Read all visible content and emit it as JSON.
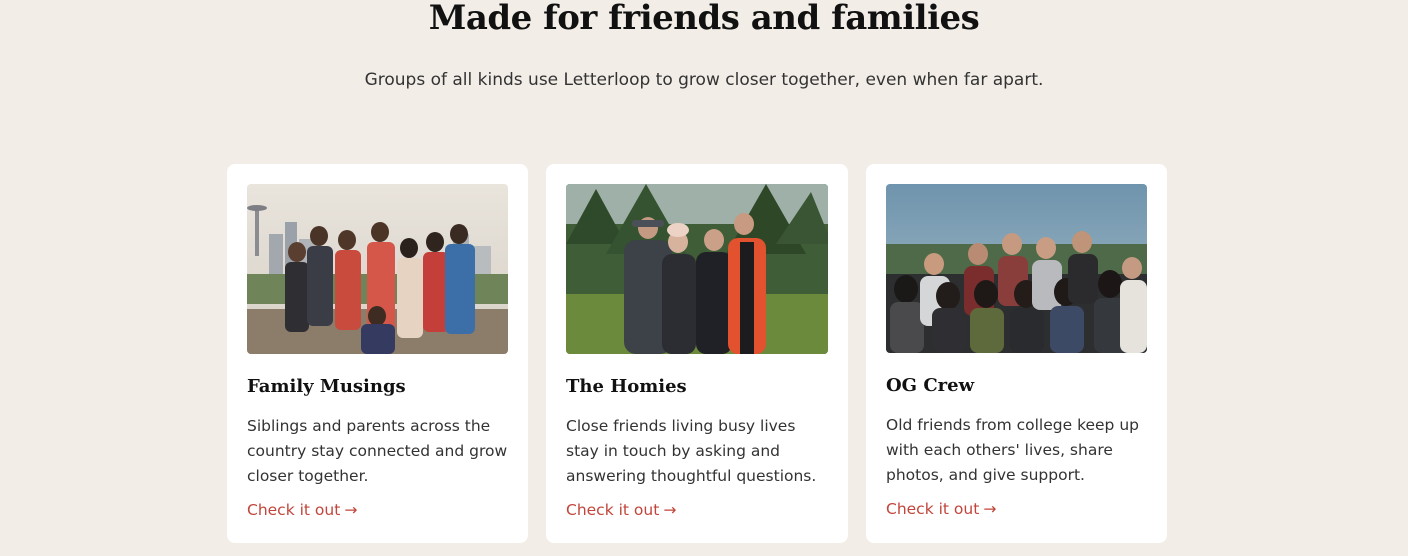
{
  "section": {
    "title": "Made for friends and families",
    "subtitle": "Groups of all kinds use Letterloop to grow closer together, even when far apart."
  },
  "cards": [
    {
      "title": "Family Musings",
      "description": "Siblings and parents across the country stay connected and grow closer together.",
      "link_label": "Check it out",
      "link_icon": "arrow-right-icon",
      "photo": "family-group-photo"
    },
    {
      "title": "The Homies",
      "description": "Close friends living busy lives stay in touch by asking and answering thoughtful questions.",
      "link_label": "Check it out",
      "link_icon": "arrow-right-icon",
      "photo": "friends-group-photo"
    },
    {
      "title": "OG Crew",
      "description": "Old friends from college keep up with each others' lives, share photos, and give support.",
      "link_label": "Check it out",
      "link_icon": "arrow-right-icon",
      "photo": "college-friends-group-photo"
    }
  ],
  "colors": {
    "background": "#f2ede7",
    "card": "#ffffff",
    "link": "#c2453b",
    "heading": "#111111"
  }
}
